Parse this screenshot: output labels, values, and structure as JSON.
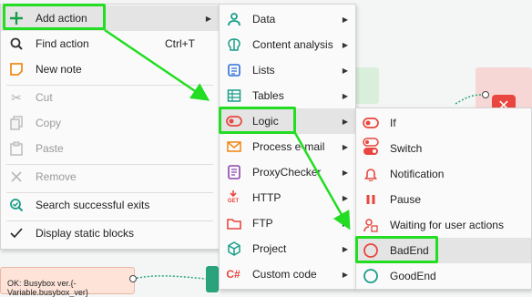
{
  "context_menu": {
    "items": [
      {
        "label": "Add action",
        "icon": "plus-icon",
        "submenu": true
      },
      {
        "label": "Find action",
        "icon": "search-icon",
        "shortcut": "Ctrl+T"
      },
      {
        "label": "New note",
        "icon": "note-icon"
      },
      {
        "label": "Cut",
        "icon": "scissors-icon",
        "disabled": true
      },
      {
        "label": "Copy",
        "icon": "copy-icon",
        "disabled": true
      },
      {
        "label": "Paste",
        "icon": "paste-icon",
        "disabled": true
      },
      {
        "label": "Remove",
        "icon": "remove-icon",
        "disabled": true
      },
      {
        "label": "Search successful exits",
        "icon": "search-check-icon"
      },
      {
        "label": "Display static blocks",
        "icon": "checkmark-icon"
      }
    ]
  },
  "actions_submenu": {
    "items": [
      {
        "label": "Data",
        "icon": "person-icon"
      },
      {
        "label": "Content analysis",
        "icon": "brain-icon"
      },
      {
        "label": "Lists",
        "icon": "list-icon"
      },
      {
        "label": "Tables",
        "icon": "table-icon"
      },
      {
        "label": "Logic",
        "icon": "toggle-icon"
      },
      {
        "label": "Process e-mail",
        "icon": "envelope-icon"
      },
      {
        "label": "ProxyChecker",
        "icon": "proxy-icon"
      },
      {
        "label": "HTTP",
        "icon": "http-get-icon",
        "icon_text": "GET"
      },
      {
        "label": "FTP",
        "icon": "folder-icon"
      },
      {
        "label": "Project",
        "icon": "cube-icon"
      },
      {
        "label": "Custom code",
        "icon": "csharp-icon",
        "icon_text": "C#"
      }
    ]
  },
  "logic_submenu": {
    "items": [
      {
        "label": "If",
        "icon": "if-toggle-icon"
      },
      {
        "label": "Switch",
        "icon": "switch-icon"
      },
      {
        "label": "Notification",
        "icon": "bell-icon"
      },
      {
        "label": "Pause",
        "icon": "pause-icon"
      },
      {
        "label": "Waiting for user actions",
        "icon": "user-wait-icon"
      },
      {
        "label": "BadEnd",
        "icon": "bad-end-circle-icon"
      },
      {
        "label": "GoodEnd",
        "icon": "good-end-circle-icon"
      }
    ]
  },
  "canvas": {
    "note_text_line1": "OK: Busybox ver.{-",
    "note_text_line2": "Variable.busybox_ver}"
  },
  "colors": {
    "highlight_green": "#22dd22",
    "icon_red": "#e8463e",
    "icon_orange": "#f08c1e",
    "icon_teal": "#1a9e8a",
    "icon_purple": "#8e44ad"
  }
}
